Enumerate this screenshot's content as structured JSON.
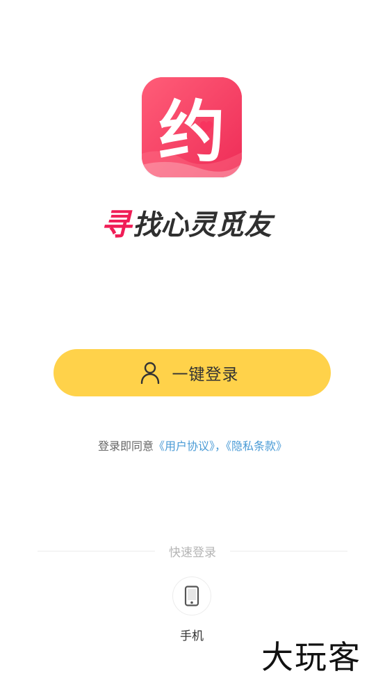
{
  "app": {
    "icon_glyph": "约",
    "slogan_mark": "寻",
    "slogan_text": "找心灵觅友"
  },
  "login": {
    "one_click_label": "一键登录"
  },
  "agreement": {
    "prefix": "登录即同意",
    "user_agreement": "《用户协议》",
    "separator": "，",
    "privacy_terms": "《隐私条款》"
  },
  "quick_login": {
    "title": "快速登录",
    "phone_label": "手机"
  },
  "watermark": "大玩客",
  "colors": {
    "brand_pink": "#f8345f",
    "button_yellow": "#ffd24a",
    "link_blue": "#4a9bd6"
  },
  "icons": {
    "user": "user-icon",
    "phone": "phone-icon"
  }
}
